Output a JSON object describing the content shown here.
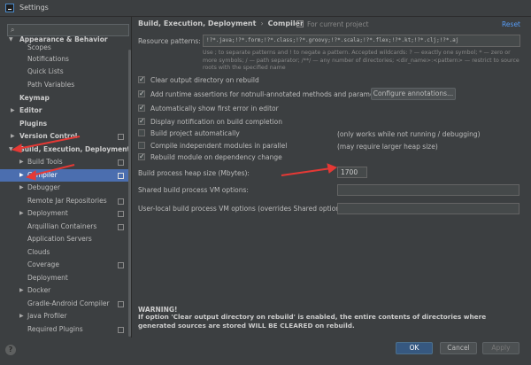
{
  "window": {
    "title": "Settings"
  },
  "search": {
    "placeholder": ""
  },
  "sidebar": {
    "items": [
      {
        "label": "Appearance & Behavior"
      },
      {
        "label": "Scopes"
      },
      {
        "label": "Notifications"
      },
      {
        "label": "Quick Lists"
      },
      {
        "label": "Path Variables"
      },
      {
        "label": "Keymap"
      },
      {
        "label": "Editor"
      },
      {
        "label": "Plugins"
      },
      {
        "label": "Version Control"
      },
      {
        "label": "Build, Execution, Deployment"
      },
      {
        "label": "Build Tools"
      },
      {
        "label": "Compiler"
      },
      {
        "label": "Debugger"
      },
      {
        "label": "Remote Jar Repositories"
      },
      {
        "label": "Deployment"
      },
      {
        "label": "Arquillian Containers"
      },
      {
        "label": "Application Servers"
      },
      {
        "label": "Clouds"
      },
      {
        "label": "Coverage"
      },
      {
        "label": "Deployment"
      },
      {
        "label": "Docker"
      },
      {
        "label": "Gradle-Android Compiler"
      },
      {
        "label": "Java Profiler"
      },
      {
        "label": "Required Plugins"
      }
    ]
  },
  "breadcrumb": {
    "section": "Build, Execution, Deployment",
    "page": "Compiler",
    "scope": "For current project"
  },
  "reset_label": "Reset",
  "resource_patterns": {
    "label": "Resource patterns:",
    "value": "!?*.java;!?*.form;!?*.class;!?*.groovy;!?*.scala;!?*.flex;!?*.kt;!?*.clj;!?*.aj",
    "hint": "Use ; to separate patterns and ! to negate a pattern. Accepted wildcards: ? — exactly one symbol; * — zero or more symbols; / — path separator; /**/ — any number of directories; <dir_name>:<pattern> — restrict to source roots with the specified name"
  },
  "options": [
    {
      "label": "Clear output directory on rebuild",
      "checked": true
    },
    {
      "label": "Add runtime assertions for notnull-annotated methods and parameters",
      "checked": true
    },
    {
      "label": "Automatically show first error in editor",
      "checked": true
    },
    {
      "label": "Display notification on build completion",
      "checked": true
    },
    {
      "label": "Build project automatically",
      "checked": false
    },
    {
      "label": "Compile independent modules in parallel",
      "checked": false
    },
    {
      "label": "Rebuild module on dependency change",
      "checked": true
    }
  ],
  "configure_annotations_label": "Configure annotations...",
  "notes": {
    "build_auto": "(only works while not running / debugging)",
    "parallel": "(may require larger heap size)"
  },
  "fields": {
    "heap_label": "Build process heap size (Mbytes):",
    "heap_value": "1700",
    "shared_vm_label": "Shared build process VM options:",
    "shared_vm_value": "",
    "user_vm_label": "User-local build process VM options (overrides Shared options):",
    "user_vm_value": ""
  },
  "warning": {
    "title": "WARNING!",
    "text": "If option 'Clear output directory on rebuild' is enabled, the entire contents of directories where generated sources are stored WILL BE CLEARED on rebuild."
  },
  "footer": {
    "ok": "OK",
    "cancel": "Cancel",
    "apply": "Apply"
  },
  "colors": {
    "background": "#3c3f41",
    "selection": "#4b6eaf",
    "link": "#589df6",
    "annotation_arrow": "#e53935"
  }
}
